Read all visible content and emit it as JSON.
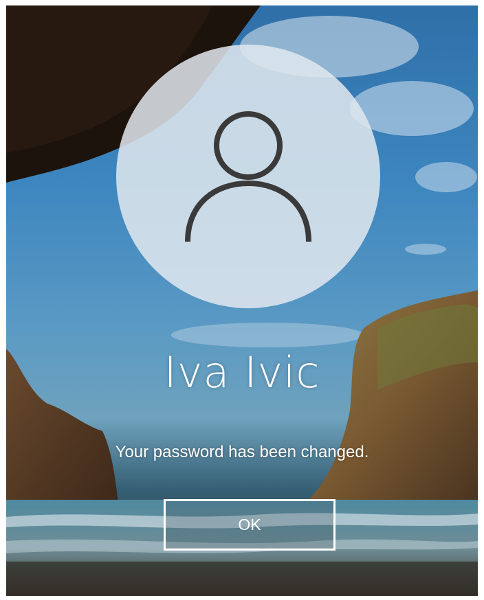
{
  "lock_screen": {
    "user_name": "Iva Ivic",
    "message": "Your password has been changed.",
    "ok_label": "OK",
    "avatar_icon": "user-silhouette-icon"
  },
  "colors": {
    "text": "#ffffff",
    "avatar_circle": "#e1e8ee",
    "avatar_glyph": "#3a3a3a",
    "button_border": "#ffffff"
  }
}
